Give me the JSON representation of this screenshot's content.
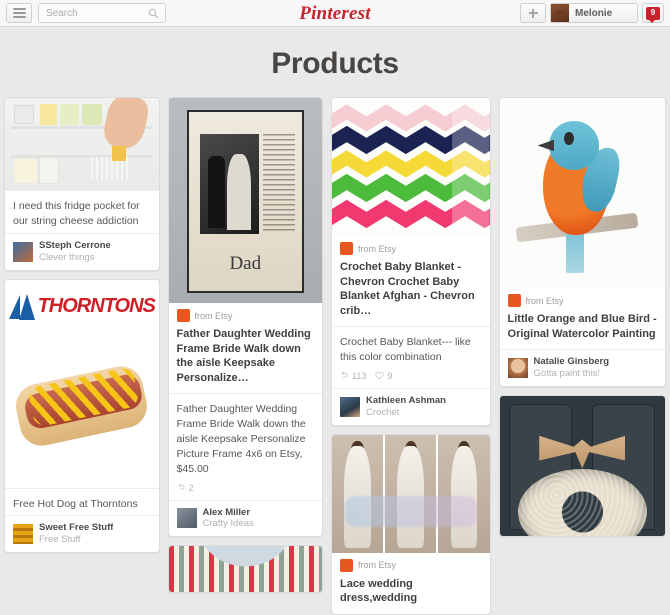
{
  "header": {
    "menu_label": "menu",
    "search_placeholder": "Search",
    "search_value": "",
    "logo_text": "Pinterest",
    "add_label": "+",
    "user_name": "Melonie",
    "notification_count": "9"
  },
  "page": {
    "title": "Products"
  },
  "labels": {
    "source_prefix": "from Etsy"
  },
  "colors": {
    "brand_red": "#c8232c",
    "etsy_orange": "#e8571f",
    "page_bg": "#e9e9e9",
    "card_bg": "#ffffff",
    "title_text": "#484542"
  },
  "columns": [
    {
      "id": "column-1",
      "pins": [
        {
          "id": "pin-fridge-pocket",
          "thumb": "fridge-pocket-photo",
          "source": null,
          "title": null,
          "description": "I need this fridge pocket for our string cheese addiction",
          "repins": null,
          "likes": null,
          "author": "SSteph Cerrone",
          "board": "Clever things"
        },
        {
          "id": "pin-free-hot-dog",
          "thumb": "thorntons-hot-dog-photo",
          "source": null,
          "title": null,
          "description": "Free Hot Dog at Thorntons",
          "repins": null,
          "likes": null,
          "author": "Sweet Free Stuff",
          "board": "Free Stuff"
        }
      ]
    },
    {
      "id": "column-2",
      "pins": [
        {
          "id": "pin-father-daughter-frame",
          "thumb": "dad-wedding-picture-frame-photo",
          "source": "from Etsy",
          "title": "Father Daughter Wedding Frame Bride Walk down the aisle Keepsake Personalize…",
          "description": "Father Daughter Wedding Frame Bride Walk down the aisle Keepsake Personalize Picture Frame 4x6 on Etsy, $45.00",
          "repins": "2",
          "likes": null,
          "author": "Alex Miller",
          "board": "Crafty Ideas"
        },
        {
          "id": "pin-knit-sweater",
          "thumb": "fair-isle-knit-sweater-photo",
          "source": null,
          "title": null,
          "description": null,
          "repins": null,
          "likes": null,
          "author": null,
          "board": null
        }
      ]
    },
    {
      "id": "column-3",
      "pins": [
        {
          "id": "pin-crochet-baby-blanket",
          "thumb": "chevron-crochet-baby-blanket-photo",
          "source": "from Etsy",
          "title": "Crochet Baby Blanket - Chevron Crochet Baby Blanket Afghan - Chevron crib…",
          "description": "Crochet Baby Blanket--- like this color combination",
          "repins": "113",
          "likes": "9",
          "author": "Kathleen Ashman",
          "board": "Crochet"
        },
        {
          "id": "pin-lace-wedding-dress",
          "thumb": "lace-wedding-dress-photo",
          "source": "from Etsy",
          "title": "Lace wedding dress,wedding",
          "description": null,
          "repins": null,
          "likes": null,
          "author": null,
          "board": null
        }
      ]
    },
    {
      "id": "column-4",
      "pins": [
        {
          "id": "pin-watercolor-bird",
          "thumb": "orange-blue-bird-watercolor-photo",
          "source": "from Etsy",
          "title": "Little Orange and Blue Bird - Original Watercolor Painting",
          "description": null,
          "repins": null,
          "likes": null,
          "author": "Natalie Ginsberg",
          "board": "Gotta paint this!"
        },
        {
          "id": "pin-wreath-door",
          "thumb": "burlap-bow-wreath-door-photo",
          "source": null,
          "title": null,
          "description": null,
          "repins": null,
          "likes": null,
          "author": null,
          "board": null
        }
      ]
    }
  ]
}
